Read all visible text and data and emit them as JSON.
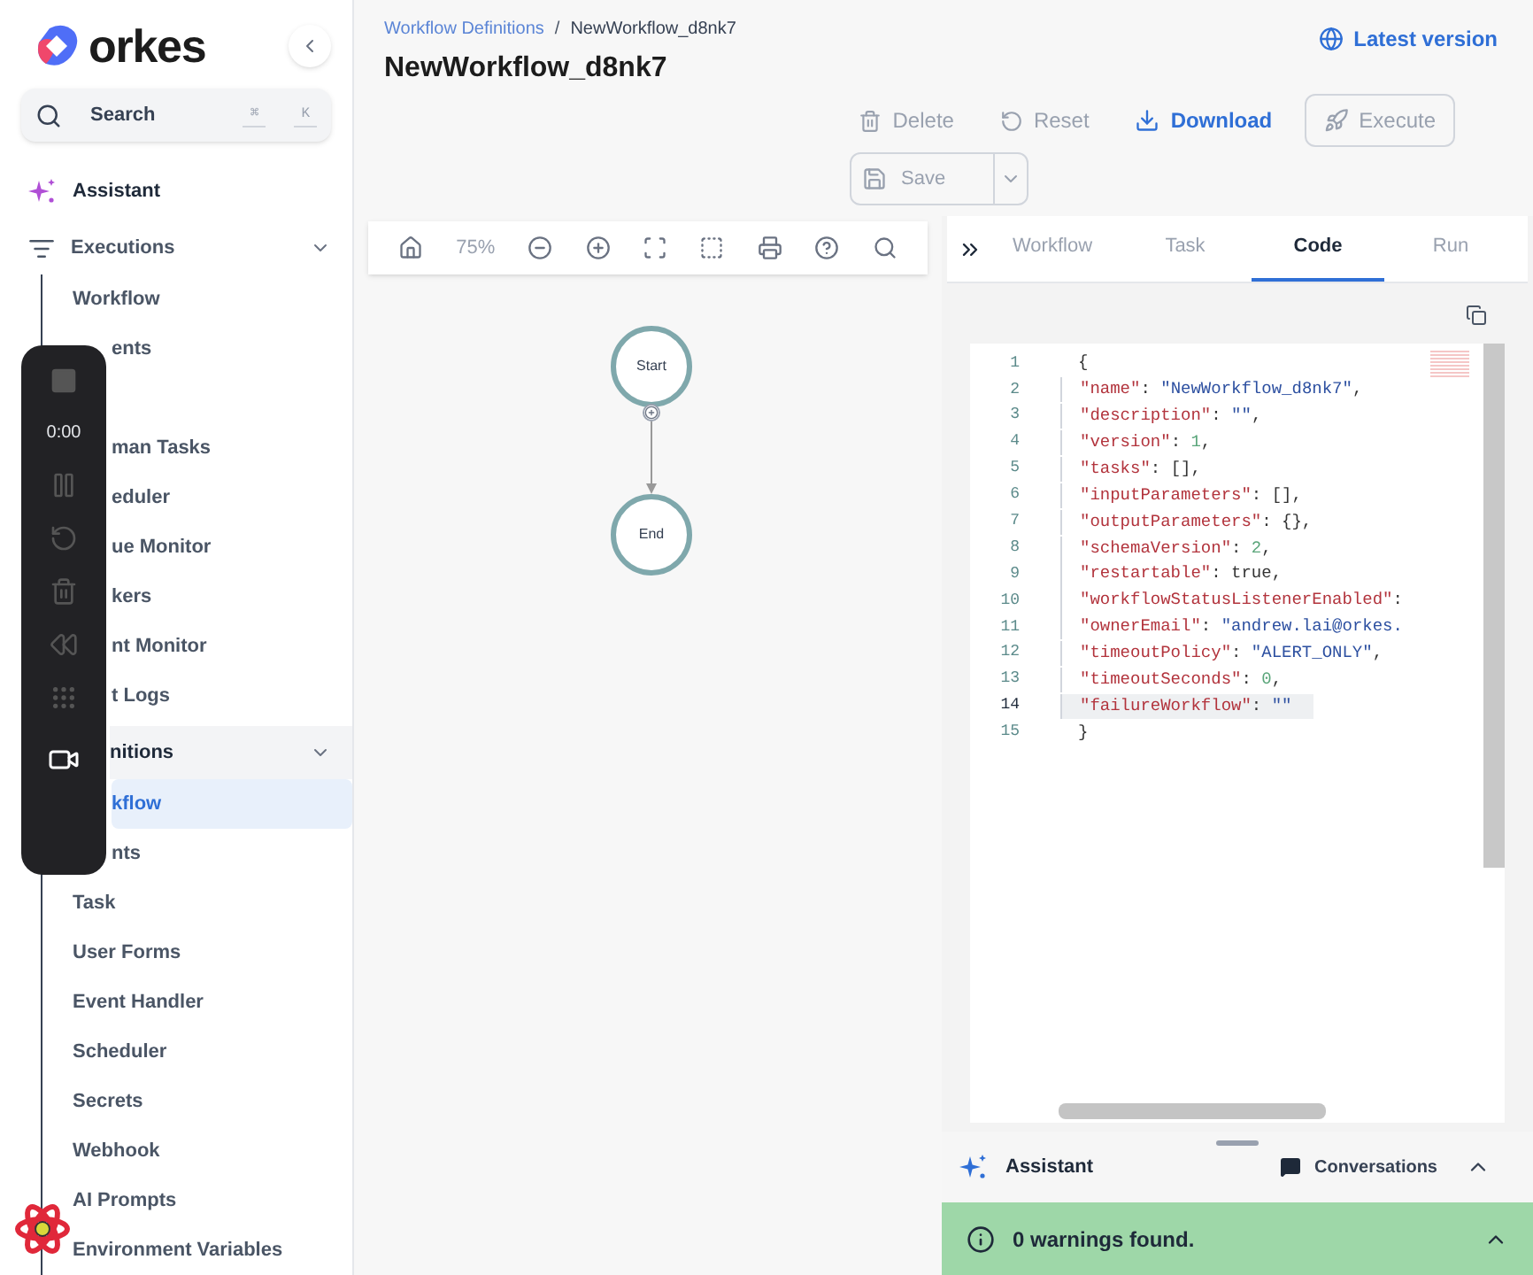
{
  "brand": {
    "name": "orkes"
  },
  "search": {
    "placeholder": "Search",
    "shortcut": [
      "⌘",
      "K"
    ]
  },
  "sidebar": {
    "items": [
      {
        "kind": "top",
        "label": "Assistant"
      },
      {
        "kind": "group",
        "label": "Executions",
        "expanded": true,
        "children": [
          {
            "kind": "item",
            "label": "Workflow",
            "selected": false
          },
          {
            "kind": "clipped",
            "label": "ents",
            "selected": false
          },
          {
            "kind": "hidden"
          },
          {
            "kind": "clipped",
            "label": "man Tasks",
            "selected": false
          },
          {
            "kind": "clipped",
            "label": "eduler",
            "selected": false
          },
          {
            "kind": "clipped",
            "label": "ue Monitor",
            "selected": false
          },
          {
            "kind": "clipped",
            "label": "kers",
            "selected": false
          },
          {
            "kind": "clipped",
            "label": "nt Monitor",
            "selected": false
          },
          {
            "kind": "clipped",
            "label": "t Logs",
            "selected": false
          }
        ]
      },
      {
        "kind": "clipped-group",
        "label": "nitions",
        "expanded": true,
        "children": [
          {
            "kind": "clipped",
            "label": "kflow",
            "selected": true
          },
          {
            "kind": "clipped",
            "label": "nts",
            "selected": false
          },
          {
            "kind": "item",
            "label": "Task",
            "selected": false
          },
          {
            "kind": "item",
            "label": "User Forms",
            "selected": false
          },
          {
            "kind": "item",
            "label": "Event Handler",
            "selected": false
          },
          {
            "kind": "item",
            "label": "Scheduler",
            "selected": false
          },
          {
            "kind": "item",
            "label": "Secrets",
            "selected": false
          },
          {
            "kind": "item",
            "label": "Webhook",
            "selected": false
          },
          {
            "kind": "item",
            "label": "AI Prompts",
            "selected": false
          },
          {
            "kind": "item",
            "label": "Environment Variables",
            "selected": false
          }
        ]
      }
    ]
  },
  "recorder": {
    "time": "0:00"
  },
  "breadcrumb": [
    "Workflow Definitions",
    "/",
    "NewWorkflow_d8nk7"
  ],
  "title": "NewWorkflow_d8nk7",
  "version_link": "Latest version",
  "actions": [
    {
      "kind": "delete",
      "label": "Delete",
      "disabled": true
    },
    {
      "kind": "reset",
      "label": "Reset",
      "disabled": true
    },
    {
      "kind": "download",
      "label": "Download",
      "disabled": false
    },
    {
      "kind": "execute",
      "label": "Execute",
      "disabled": true
    }
  ],
  "save": {
    "label": "Save",
    "disabled": true
  },
  "canvas_toolbar": {
    "zoom": "75%"
  },
  "nodes": [
    {
      "label": "Start"
    },
    {
      "label": "End"
    }
  ],
  "tabs": [
    {
      "label": "Workflow",
      "selected": false
    },
    {
      "label": "Task",
      "selected": false
    },
    {
      "label": "Code",
      "selected": true
    },
    {
      "label": "Run",
      "selected": false
    }
  ],
  "code": {
    "lines": [
      {
        "number": "1",
        "selected": false,
        "tokens": [
          {
            "kind": "punct",
            "text": "{"
          }
        ]
      },
      {
        "number": "2",
        "selected": false,
        "tokens": [
          {
            "kind": "key",
            "text": "\"name\""
          },
          {
            "kind": "punct",
            "text": ": "
          },
          {
            "kind": "string",
            "text": "\"NewWorkflow_d8nk7\""
          },
          {
            "kind": "punct",
            "text": ","
          }
        ]
      },
      {
        "number": "3",
        "selected": false,
        "tokens": [
          {
            "kind": "key",
            "text": "\"description\""
          },
          {
            "kind": "punct",
            "text": ": "
          },
          {
            "kind": "string",
            "text": "\"\""
          },
          {
            "kind": "punct",
            "text": ","
          }
        ]
      },
      {
        "number": "4",
        "selected": false,
        "tokens": [
          {
            "kind": "key",
            "text": "\"version\""
          },
          {
            "kind": "punct",
            "text": ": "
          },
          {
            "kind": "number",
            "text": "1"
          },
          {
            "kind": "punct",
            "text": ","
          }
        ]
      },
      {
        "number": "5",
        "selected": false,
        "tokens": [
          {
            "kind": "key",
            "text": "\"tasks\""
          },
          {
            "kind": "punct",
            "text": ": [],"
          }
        ]
      },
      {
        "number": "6",
        "selected": false,
        "tokens": [
          {
            "kind": "key",
            "text": "\"inputParameters\""
          },
          {
            "kind": "punct",
            "text": ": [],"
          }
        ]
      },
      {
        "number": "7",
        "selected": false,
        "tokens": [
          {
            "kind": "key",
            "text": "\"outputParameters\""
          },
          {
            "kind": "punct",
            "text": ": {},"
          }
        ]
      },
      {
        "number": "8",
        "selected": false,
        "tokens": [
          {
            "kind": "key",
            "text": "\"schemaVersion\""
          },
          {
            "kind": "punct",
            "text": ": "
          },
          {
            "kind": "number",
            "text": "2"
          },
          {
            "kind": "punct",
            "text": ","
          }
        ]
      },
      {
        "number": "9",
        "selected": false,
        "tokens": [
          {
            "kind": "key",
            "text": "\"restartable\""
          },
          {
            "kind": "punct",
            "text": ": true,"
          }
        ]
      },
      {
        "number": "10",
        "selected": false,
        "tokens": [
          {
            "kind": "key",
            "text": "\"workflowStatusListenerEnabled\""
          },
          {
            "kind": "punct",
            "text": ":"
          }
        ]
      },
      {
        "number": "11",
        "selected": false,
        "tokens": [
          {
            "kind": "key",
            "text": "\"ownerEmail\""
          },
          {
            "kind": "punct",
            "text": ": "
          },
          {
            "kind": "string",
            "text": "\"andrew.lai@orkes."
          }
        ]
      },
      {
        "number": "12",
        "selected": false,
        "tokens": [
          {
            "kind": "key",
            "text": "\"timeoutPolicy\""
          },
          {
            "kind": "punct",
            "text": ": "
          },
          {
            "kind": "string",
            "text": "\"ALERT_ONLY\""
          },
          {
            "kind": "punct",
            "text": ","
          }
        ]
      },
      {
        "number": "13",
        "selected": false,
        "tokens": [
          {
            "kind": "key",
            "text": "\"timeoutSeconds\""
          },
          {
            "kind": "punct",
            "text": ": "
          },
          {
            "kind": "number",
            "text": "0"
          },
          {
            "kind": "punct",
            "text": ","
          }
        ]
      },
      {
        "number": "14",
        "selected": true,
        "tokens": [
          {
            "kind": "key",
            "text": "\"failureWorkflow\""
          },
          {
            "kind": "punct",
            "text": ": "
          },
          {
            "kind": "string",
            "text": "\"\""
          }
        ]
      },
      {
        "number": "15",
        "selected": false,
        "tokens": [
          {
            "kind": "punct",
            "text": "}"
          }
        ]
      }
    ]
  },
  "assistant_bar": {
    "label": "Assistant",
    "conversations": "Conversations"
  },
  "status": {
    "message": "0 warnings found."
  }
}
